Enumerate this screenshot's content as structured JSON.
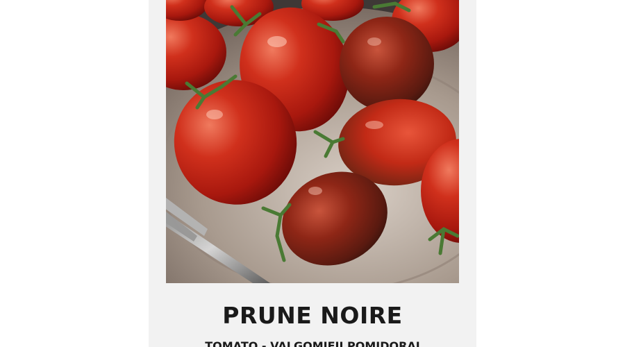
{
  "product": {
    "image_alt": "",
    "name": "PRUNE NOIRE",
    "subtitle": "TOMATO - VALGOMIEJI POMIDORAI"
  },
  "colors": {
    "card_background": "#f2f2f2",
    "page_background": "#ffffff",
    "text": "#1a1a1a"
  }
}
